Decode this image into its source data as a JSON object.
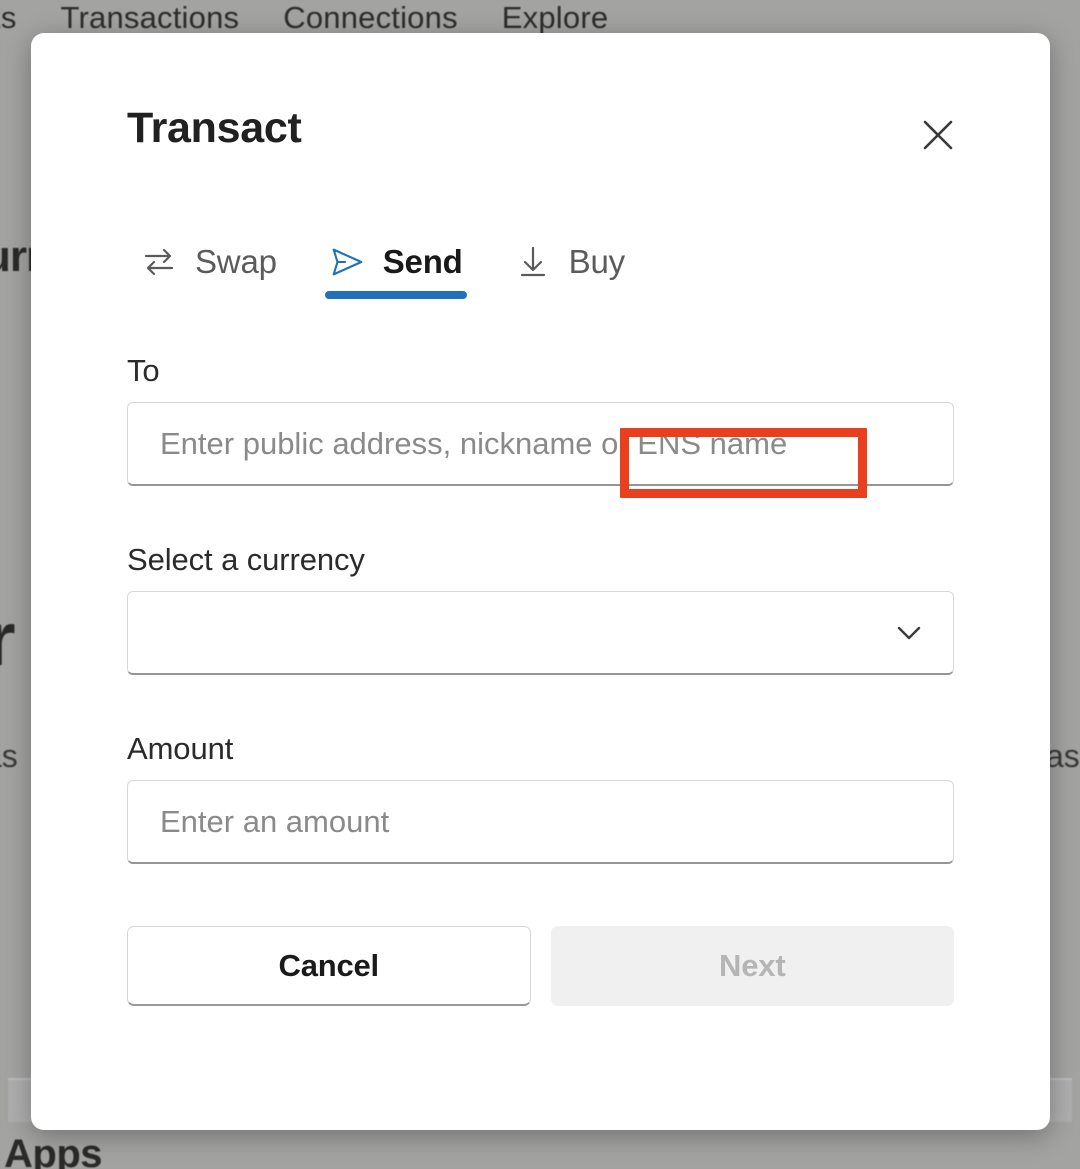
{
  "background": {
    "nav_items": [
      {
        "label": "ts"
      },
      {
        "label": "Transactions"
      },
      {
        "label": "Connections"
      },
      {
        "label": "Explore"
      }
    ],
    "fragments": {
      "left_top": "urr",
      "left_mid": "r",
      "left_low": "as",
      "right_low": "as",
      "bottom": "Apps"
    }
  },
  "modal": {
    "title": "Transact",
    "close_icon": "close-icon",
    "tabs": [
      {
        "label": "Swap",
        "icon": "swap-arrows-icon",
        "active": false
      },
      {
        "label": "Send",
        "icon": "send-paper-plane-icon",
        "active": true
      },
      {
        "label": "Buy",
        "icon": "download-arrow-icon",
        "active": false
      }
    ],
    "fields": {
      "to": {
        "label": "To",
        "placeholder": "Enter public address, nickname or ENS name",
        "value": ""
      },
      "currency": {
        "label": "Select a currency",
        "placeholder": "",
        "value": "",
        "chevron_icon": "chevron-down-icon"
      },
      "amount": {
        "label": "Amount",
        "placeholder": "Enter an amount",
        "value": ""
      }
    },
    "footer": {
      "cancel_label": "Cancel",
      "next_label": "Next"
    }
  },
  "annotation": {
    "highlight_label": "or ENS name",
    "highlight_color": "#e8401f"
  },
  "colors": {
    "accent_blue": "#1f72ba",
    "annotation_red": "#e8401f",
    "text_primary": "#212121",
    "text_muted": "#8a8a8a",
    "disabled_bg": "#f0f0f0"
  }
}
